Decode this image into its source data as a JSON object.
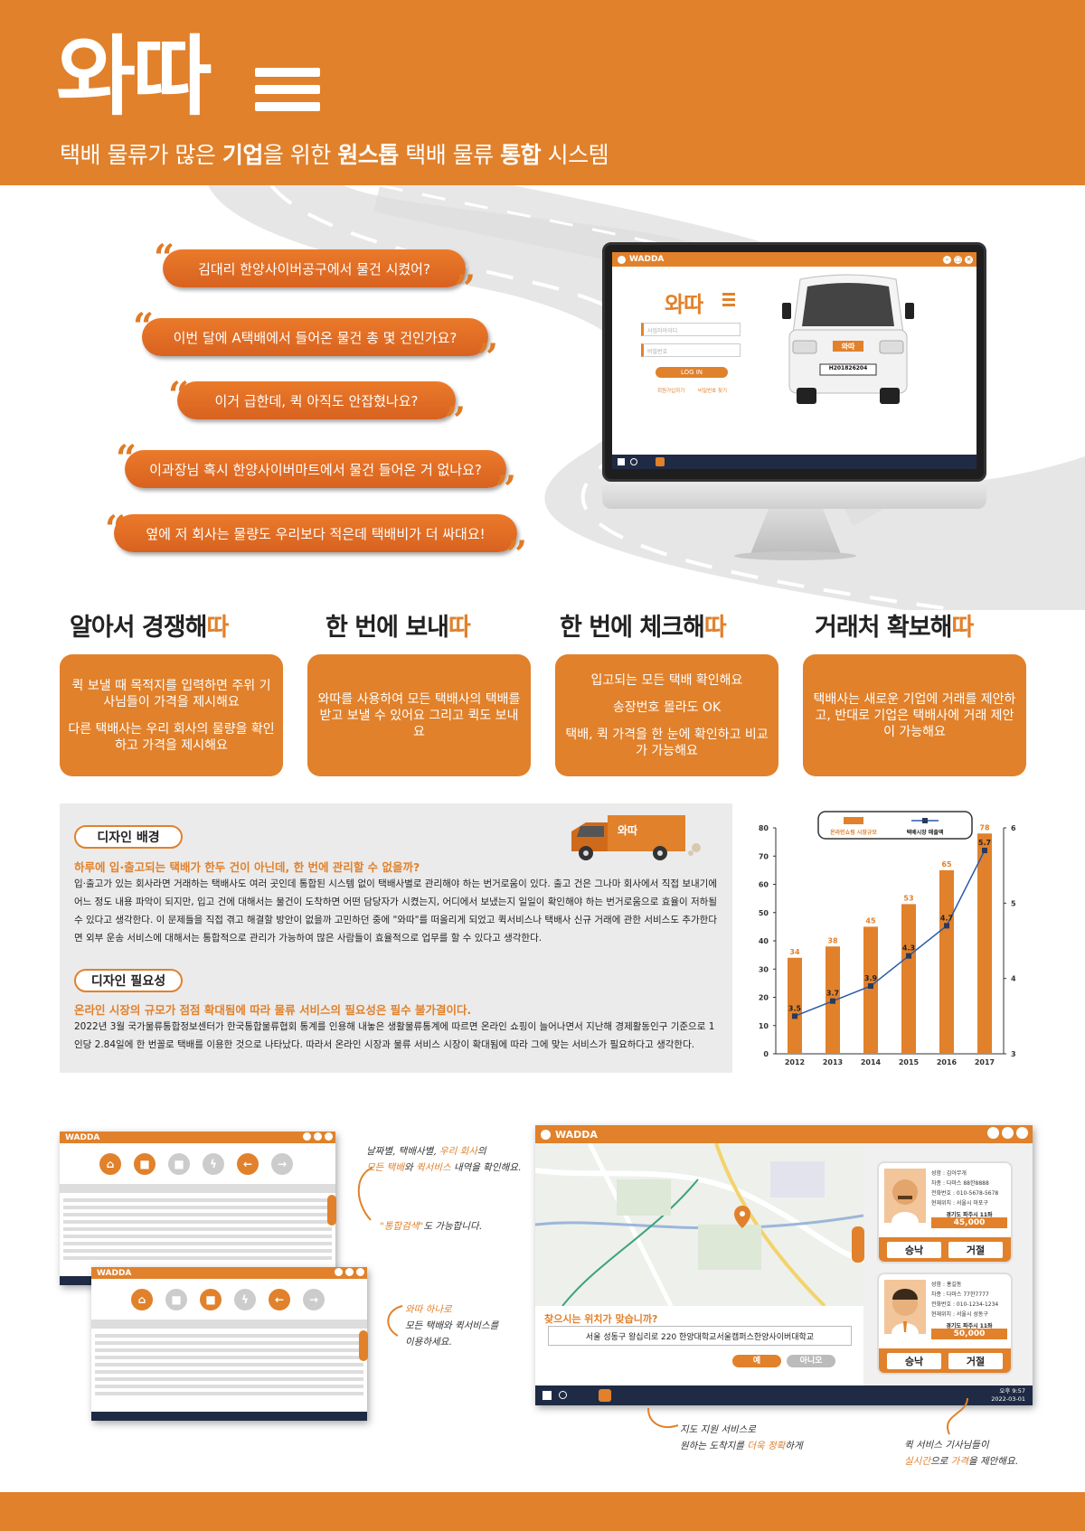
{
  "header": {
    "logo": "와따",
    "tagline_parts": [
      "택배 물류가 많은 ",
      "기업",
      "을 위한 ",
      "원스톱",
      " 택배 물류 ",
      "통합",
      " 시스템"
    ]
  },
  "bubbles": [
    "김대리 한양사이버공구에서 물건 시켰어?",
    "이번 달에 A택배에서 들어온 물건 총 몇 건인가요?",
    "이거 급한데, 퀵 아직도 안잡혔나요?",
    "이과장님 혹시 한양사이버마트에서 물건 들어온 거 없나요?",
    "옆에 저 회사는 물량도 우리보다 적은데 택배비가 더 싸대요!"
  ],
  "monitor": {
    "window_title": "WADDA",
    "logo": "와따",
    "id_placeholder": "사업자아이디",
    "pw_placeholder": "비밀번호",
    "login_button": "LOG IN",
    "signup_link": "회원가입하기",
    "find_pw_link": "비밀번호 찾기",
    "truck_plate": "H201826204",
    "truck_logo": "와따"
  },
  "features": [
    {
      "heading": "알아서 경쟁해",
      "accent": "따",
      "lines": [
        "퀵 보낼 때 목적지를 입력하면 주위 기사님들이 가격을 제시해요",
        "다른 택배사는 우리 회사의 물량을 확인하고 가격을 제시해요"
      ]
    },
    {
      "heading": "한 번에 보내",
      "accent": "따",
      "lines": [
        "와따를 사용하여 모든 택배사의 택배를 받고 보낼 수 있어요 그리고 퀵도 보내요"
      ]
    },
    {
      "heading": "한 번에 체크해",
      "accent": "따",
      "lines": [
        "입고되는 모든 택배 확인해요",
        "송장번호 몰라도 OK",
        "택배, 퀵 가격을 한 눈에 확인하고 비교가 가능해요"
      ]
    },
    {
      "heading": "거래처 확보해",
      "accent": "따",
      "lines": [
        "택배사는 새로운 기업에 거래를 제안하고, 반대로 기업은 택배사에 거래 제안이 가능해요"
      ]
    }
  ],
  "design": {
    "bg_title": "디자인 배경",
    "bg_highlight": "하루에 입·출고되는 택배가 한두 건이 아닌데, 한 번에 관리할 수 없을까?",
    "bg_text": "입·출고가 있는 회사라면 거래하는 택배사도 여러 곳인데 통합된 시스템 없이 택배사별로 관리해야 하는 번거로움이 있다. 출고 건은 그나마 회사에서 직접 보내기에 어느 정도 내용 파악이 되지만, 입고 건에 대해서는 물건이 도착하면 어떤 담당자가 시켰는지, 어디에서 보냈는지 일일이 확인해야 하는 번거로움으로 효율이 저하될 수 있다고 생각한다. 이 문제들을 직접 겪고 해결할 방안이 없을까 고민하던 중에 \"와따\"를 떠올리게 되었고 퀵서비스나 택배사 신규 거래에 관한 서비스도 추가한다면 외부 운송 서비스에 대해서는 통합적으로 관리가 가능하여 많은 사람들이 효율적으로 업무를 할 수 있다고 생각한다.",
    "need_title": "디자인 필요성",
    "need_highlight": "온라인 시장의 규모가 점점 확대됨에 따라 물류 서비스의 필요성은 필수 불가결이다.",
    "need_text": "2022년 3월 국가물류통합정보센터가 한국통합물류협회 통계를 인용해 내놓은 생활물류통계에 따르면 온라인 쇼핑이 늘어나면서 지난해 경제활동인구 기준으로 1인당 2.84일에 한 번꼴로 택배를 이용한 것으로 나타났다. 따라서 온라인 시장과 물류 서비스 시장이 확대됨에 따라 그에 맞는 서비스가 필요하다고 생각한다.",
    "truck_logo": "와따"
  },
  "chart_data": {
    "type": "bar",
    "categories": [
      "2012",
      "2013",
      "2014",
      "2015",
      "2016",
      "2017"
    ],
    "series": [
      {
        "name": "온라인쇼핑 시장규모",
        "type": "bar",
        "axis": "left",
        "values": [
          34,
          38,
          45,
          53,
          65,
          78
        ]
      },
      {
        "name": "택배시장 매출액",
        "type": "line",
        "axis": "right",
        "values": [
          3.5,
          3.7,
          3.9,
          4.3,
          4.7,
          5.7
        ]
      }
    ],
    "ylim_left": [
      0,
      80
    ],
    "yticks_left": [
      "0",
      "10",
      "20",
      "30",
      "40",
      "50",
      "60",
      "70",
      "80"
    ],
    "ylim_right": [
      3,
      6
    ],
    "yticks_right": [
      "3",
      "4",
      "5",
      "6"
    ],
    "legend_position": "top",
    "colors": {
      "bar": "#e1812b",
      "line": "#2a5aa8"
    }
  },
  "screens": {
    "small_title": "WADDA",
    "map_title": "WADDA",
    "map_question": "찾으시는 위치가 맞습니까?",
    "map_address": "서울 성동구 왕십리로 220 한양대학교서울캠퍼스한양사이버대학교",
    "yes": "예",
    "no": "아니오",
    "clock": "오후 9:57",
    "date": "2022-03-01",
    "offers": [
      {
        "name": "성함 : 김아무개",
        "car": "차종 : 다마스 88한8888",
        "phone": "전화번호 : 010-5678-5678",
        "loc": "현재위치 : 서울시 마포구",
        "dest": "경기도 파주시 11좌",
        "price": "45,000",
        "accept": "승낙",
        "reject": "거절"
      },
      {
        "name": "성함 : 홍길동",
        "car": "차종 : 다마스 77한7777",
        "phone": "전화번호 : 010-1234-1234",
        "loc": "현재위치 : 서울시 성동구",
        "dest": "경기도 파주시 11좌",
        "price": "50,000",
        "accept": "승낙",
        "reject": "거절"
      }
    ]
  },
  "notes": {
    "n1a": "날짜별, 택배사별, ",
    "n1b": "우리 회사",
    "n1c": "의",
    "n1d": "모든 택배",
    "n1e": "와 ",
    "n1f": "퀵서비스",
    "n1g": " 내역을 확인해요.",
    "n2a": "\"통합검색\"",
    "n2b": "도 가능합니다.",
    "n3a": "와따 하나로",
    "n3b": "모든 택배와 퀵서비스를",
    "n3c": "이용하세요.",
    "n4a": "지도 지원 서비스로",
    "n4b": "원하는 도착지를 ",
    "n4c": "더욱 정확",
    "n4d": "하게",
    "n5a": "퀵 서비스 기사님들이",
    "n5b": "실시간",
    "n5c": "으로 ",
    "n5d": "가격",
    "n5e": "을 제안해요."
  }
}
